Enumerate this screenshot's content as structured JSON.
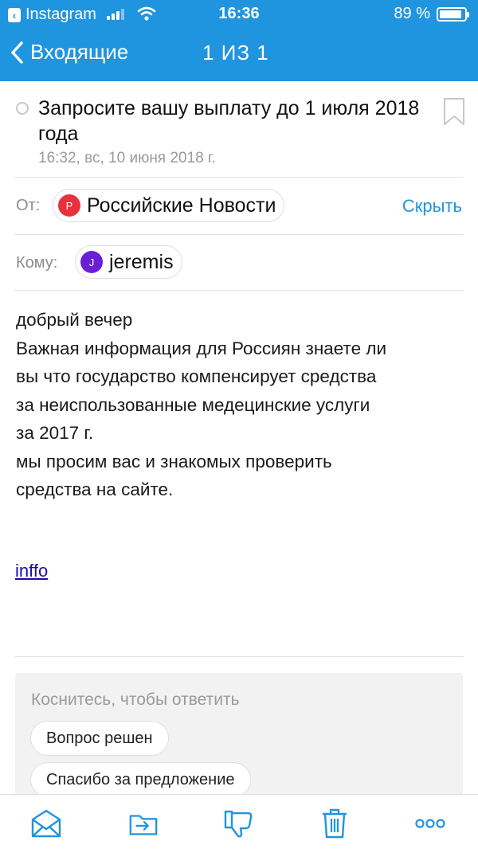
{
  "status_bar": {
    "back_app": "Instagram",
    "time": "16:36",
    "battery": "89 %",
    "battery_level": 0.89
  },
  "nav": {
    "back_label": "Входящие",
    "counter": "1 ИЗ 1"
  },
  "message": {
    "subject": "Запросите вашу выплату до 1 июля 2018 года",
    "date": "16:32, вс, 10 июня 2018 г.",
    "from_label": "От:",
    "from_initial": "Р",
    "from_name": "Российские Новости",
    "hide_label": "Скрыть",
    "to_label": "Кому:",
    "to_initial": "J",
    "to_name": "jeremis",
    "body_lines": [
      "добрый вечер",
      "Важная информация для Россиян знаете ли",
      "вы что государство компенсирует средства",
      "за неиспользованные медецинские услуги",
      "за 2017 г.",
      "мы просим вас и знакомых проверить",
      "средства на сайте."
    ],
    "link_text": "inffo"
  },
  "reply": {
    "hint": "Коснитесь, чтобы ответить",
    "suggestions": [
      "Вопрос решен",
      "Спасибо за предложение"
    ]
  },
  "toolbar": {
    "icons": [
      "move-to-folder-icon",
      "move-icon",
      "spam-icon",
      "trash-icon",
      "more-icon"
    ]
  },
  "colors": {
    "accent": "#1f95e0",
    "sender_avatar": "#e8313c",
    "recipient_avatar": "#6a1fd6",
    "link": "#1a0dab"
  }
}
